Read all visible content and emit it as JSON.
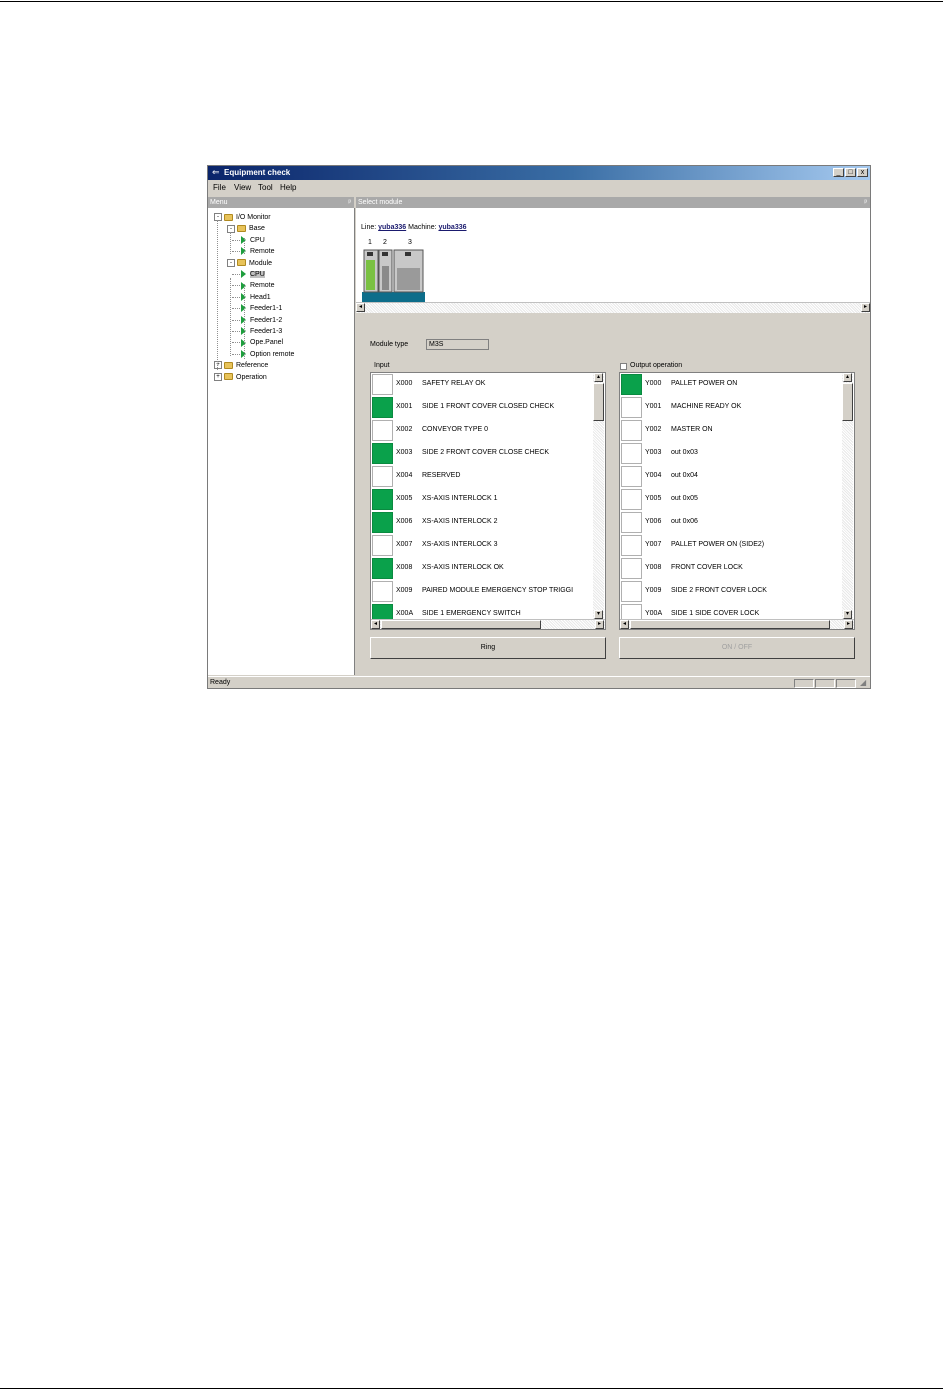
{
  "window": {
    "title": "Equipment check",
    "icon": "app-icon",
    "controls": [
      "_",
      "□",
      "x"
    ]
  },
  "menubar": [
    "File",
    "View",
    "Tool",
    "Help"
  ],
  "menu_pane": {
    "header": "Menu",
    "pin": "ᵖ",
    "tree": [
      {
        "label": "I/O Monitor",
        "type": "folder",
        "expander": "-",
        "level": 0
      },
      {
        "label": "Base",
        "type": "folder",
        "expander": "-",
        "level": 1
      },
      {
        "label": "CPU",
        "type": "leaf",
        "level": 2
      },
      {
        "label": "Remote",
        "type": "leaf",
        "level": 2
      },
      {
        "label": "Module",
        "type": "folder",
        "expander": "-",
        "level": 1
      },
      {
        "label": "CPU",
        "type": "leaf",
        "level": 2,
        "selected": true
      },
      {
        "label": "Remote",
        "type": "leaf",
        "level": 2
      },
      {
        "label": "Head1",
        "type": "leaf",
        "level": 2
      },
      {
        "label": "Feeder1-1",
        "type": "leaf",
        "level": 2
      },
      {
        "label": "Feeder1-2",
        "type": "leaf",
        "level": 2
      },
      {
        "label": "Feeder1-3",
        "type": "leaf",
        "level": 2
      },
      {
        "label": "Ope.Panel",
        "type": "leaf",
        "level": 2
      },
      {
        "label": "Option remote",
        "type": "leaf",
        "level": 2
      },
      {
        "label": "Reference",
        "type": "folder",
        "expander": "+",
        "level": 0
      },
      {
        "label": "Operation",
        "type": "folder",
        "expander": "+",
        "level": 0
      }
    ]
  },
  "select_module": {
    "header": "Select module",
    "pin": "ᵖ",
    "line_label": "Line:",
    "line_value": "yuba336",
    "machine_label": "Machine:",
    "machine_value": "yuba336",
    "slots": [
      "1",
      "2",
      "3"
    ]
  },
  "module_type": {
    "label": "Module type",
    "value": "M3S"
  },
  "input": {
    "label": "Input",
    "rows": [
      {
        "code": "X000",
        "name": "SAFETY RELAY OK",
        "on": false
      },
      {
        "code": "X001",
        "name": "SIDE 1 FRONT COVER CLOSED CHECK",
        "on": true
      },
      {
        "code": "X002",
        "name": "CONVEYOR TYPE 0",
        "on": false
      },
      {
        "code": "X003",
        "name": "SIDE 2 FRONT COVER CLOSE CHECK",
        "on": true
      },
      {
        "code": "X004",
        "name": "RESERVED",
        "on": false
      },
      {
        "code": "X005",
        "name": "XS-AXIS INTERLOCK 1",
        "on": true
      },
      {
        "code": "X006",
        "name": "XS-AXIS INTERLOCK 2",
        "on": true
      },
      {
        "code": "X007",
        "name": "XS-AXIS INTERLOCK 3",
        "on": false
      },
      {
        "code": "X008",
        "name": "XS-AXIS INTERLOCK OK",
        "on": true
      },
      {
        "code": "X009",
        "name": "PAIRED MODULE EMERGENCY STOP TRIGGI",
        "on": false
      },
      {
        "code": "X00A",
        "name": "SIDE 1 EMERGENCY SWITCH",
        "on": true
      }
    ],
    "button": "Ring"
  },
  "output": {
    "checkbox_label": "Output operation",
    "checked": false,
    "rows": [
      {
        "code": "Y000",
        "name": "PALLET POWER ON",
        "on": true
      },
      {
        "code": "Y001",
        "name": "MACHINE READY OK",
        "on": false
      },
      {
        "code": "Y002",
        "name": "MASTER ON",
        "on": false
      },
      {
        "code": "Y003",
        "name": "out 0x03",
        "on": false
      },
      {
        "code": "Y004",
        "name": "out 0x04",
        "on": false
      },
      {
        "code": "Y005",
        "name": "out 0x05",
        "on": false
      },
      {
        "code": "Y006",
        "name": "out 0x06",
        "on": false
      },
      {
        "code": "Y007",
        "name": "PALLET POWER ON (SIDE2)",
        "on": false
      },
      {
        "code": "Y008",
        "name": "FRONT COVER LOCK",
        "on": false
      },
      {
        "code": "Y009",
        "name": "SIDE 2 FRONT COVER LOCK",
        "on": false
      },
      {
        "code": "Y00A",
        "name": "SIDE 1 SIDE COVER LOCK",
        "on": false
      }
    ],
    "button": "ON / OFF"
  },
  "status": {
    "text": "Ready"
  },
  "colors": {
    "lamp_on": "#0aa14b",
    "title_bar": "#0a246a"
  }
}
